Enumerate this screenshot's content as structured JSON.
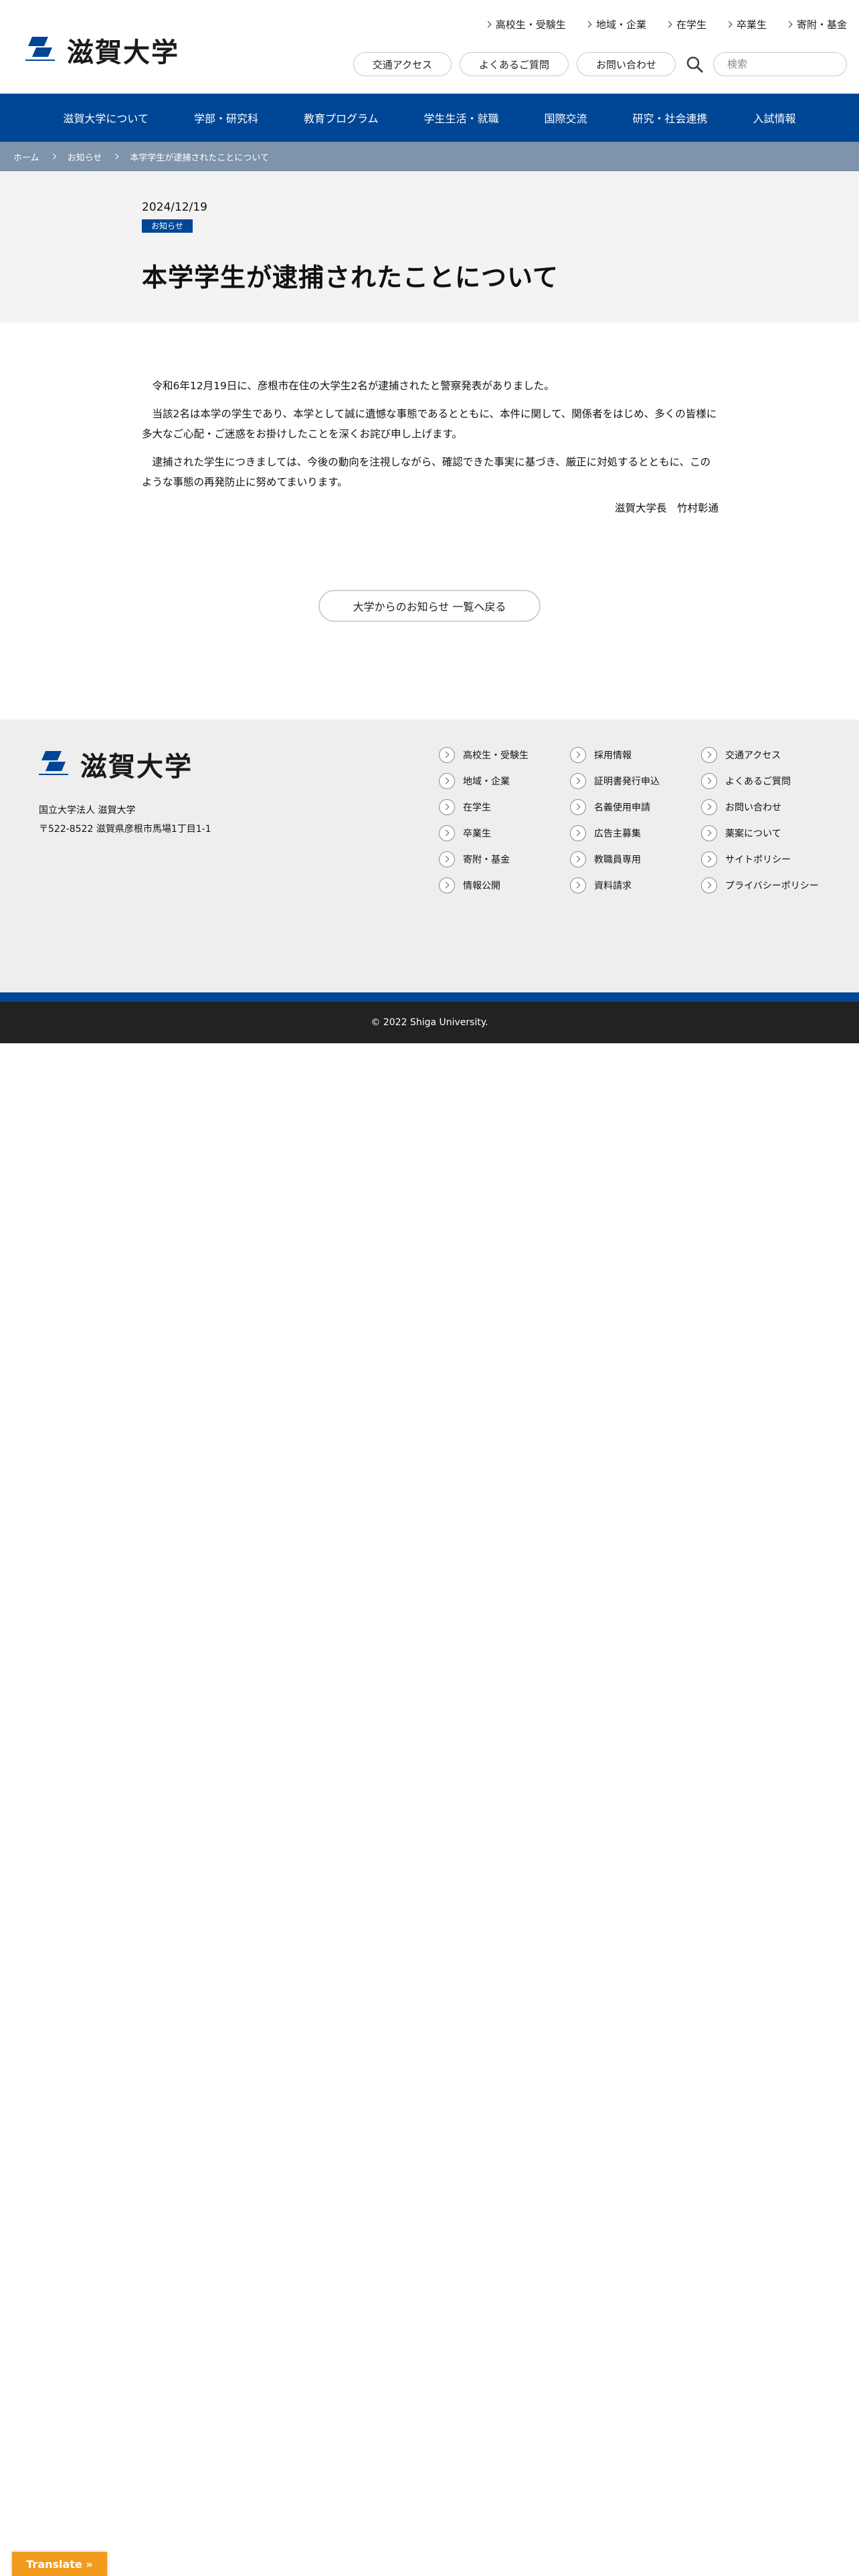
{
  "header": {
    "logo_text": "滋賀大学",
    "util_links": [
      "高校生・受験生",
      "地域・企業",
      "在学生",
      "卒業生",
      "寄附・基金"
    ],
    "pills": [
      "交通アクセス",
      "よくあるご質問",
      "お問い合わせ"
    ],
    "search_placeholder": "検索"
  },
  "nav": {
    "items": [
      "滋賀大学について",
      "学部・研究科",
      "教育プログラム",
      "学生生活・就職",
      "国際交流",
      "研究・社会連携",
      "入試情報"
    ]
  },
  "breadcrumb": [
    "ホーム",
    "お知らせ",
    "本学学生が逮捕されたことについて"
  ],
  "post": {
    "date": "2024/12/19",
    "category": "お知らせ",
    "title": "本学学生が逮捕されたことについて",
    "paragraphs": [
      "令和6年12月19日に、彦根市在住の大学生2名が逮捕されたと警察発表がありました。",
      "当該2名は本学の学生であり、本学として誠に遺憾な事態であるとともに、本件に関して、関係者をはじめ、多くの皆様に多大なご心配・ご迷惑をお掛けしたことを深くお詫び申し上げます。",
      "逮捕された学生につきましては、今後の動向を注視しながら、確認できた事実に基づき、厳正に対処するとともに、このような事態の再発防止に努めてまいります。"
    ],
    "signature": "滋賀大学長　竹村彰通",
    "back_label": "大学からのお知らせ 一覧へ戻る"
  },
  "footer": {
    "logo_text": "滋賀大学",
    "org": "国立大学法人 滋賀大学",
    "address": "〒522-8522 滋賀県彦根市馬場1丁目1-1",
    "links": [
      "高校生・受験生",
      "採用情報",
      "交通アクセス",
      "地域・企業",
      "証明書発行申込",
      "よくあるご質問",
      "在学生",
      "名義使用申請",
      "お問い合わせ",
      "卒業生",
      "広告主募集",
      "薬案について",
      "寄附・基金",
      "教職員専用",
      "サイトポリシー",
      "情報公開",
      "資料請求",
      "プライバシーポリシー"
    ],
    "copyright": "© 2022 Shiga University."
  },
  "translate_label": "Translate »",
  "colors": {
    "brand_blue": "#004696",
    "breadcrumb_bg": "#7d94aa",
    "translate_orange": "#f29a1c"
  }
}
